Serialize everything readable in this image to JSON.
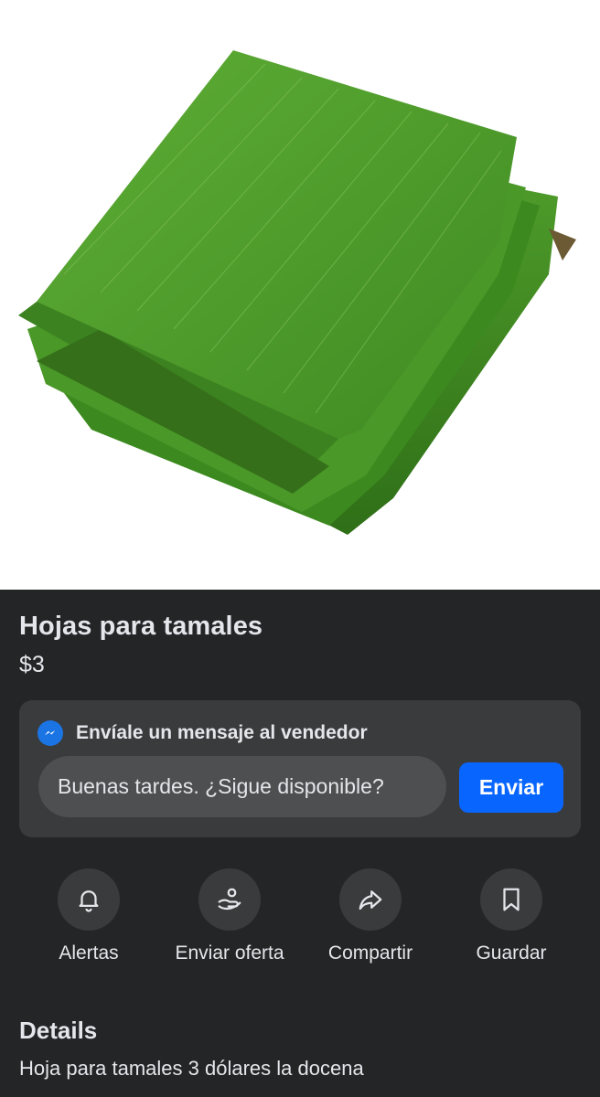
{
  "listing": {
    "title": "Hojas para tamales",
    "price": "$3"
  },
  "message_card": {
    "heading": "Envíale un mensaje al vendedor",
    "input_value": "Buenas tardes. ¿Sigue disponible?",
    "send_label": "Enviar",
    "icon": "messenger-icon"
  },
  "actions": [
    {
      "label": "Alertas",
      "icon": "bell-icon"
    },
    {
      "label": "Enviar oferta",
      "icon": "offer-icon"
    },
    {
      "label": "Compartir",
      "icon": "share-icon"
    },
    {
      "label": "Guardar",
      "icon": "bookmark-icon"
    }
  ],
  "details": {
    "title": "Details",
    "text": "Hoja para tamales 3 dólares la docena"
  },
  "colors": {
    "background": "#242526",
    "card": "#3a3b3c",
    "accent": "#0866ff",
    "photo_background": "#ffffff",
    "leaf_green": "#4f9a2c"
  }
}
